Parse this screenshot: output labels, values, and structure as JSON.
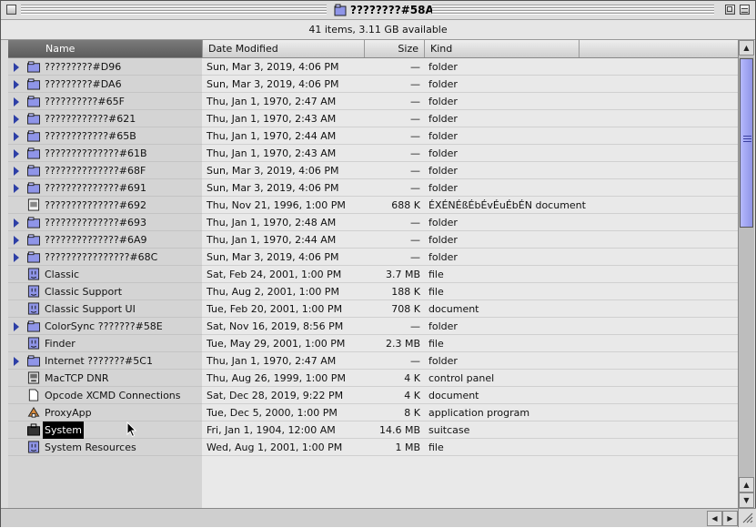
{
  "window": {
    "title": "????????#58A"
  },
  "status_text": "41 items, 3.11 GB available",
  "columns": {
    "name": "Name",
    "date": "Date Modified",
    "size": "Size",
    "kind": "Kind"
  },
  "rows": [
    {
      "name": "?????????#D96",
      "date": "Sun, Mar 3, 2019, 4:06 PM",
      "size": "—",
      "kind": "folder",
      "icon": "folder-icon",
      "expand": true
    },
    {
      "name": "?????????#DA6",
      "date": "Sun, Mar 3, 2019, 4:06 PM",
      "size": "—",
      "kind": "folder",
      "icon": "folder-icon",
      "expand": true
    },
    {
      "name": "??????????#65F",
      "date": "Thu, Jan 1, 1970, 2:47 AM",
      "size": "—",
      "kind": "folder",
      "icon": "folder-icon",
      "expand": true
    },
    {
      "name": "????????????#621",
      "date": "Thu, Jan 1, 1970, 2:43 AM",
      "size": "—",
      "kind": "folder",
      "icon": "folder-icon",
      "expand": true
    },
    {
      "name": "????????????#65B",
      "date": "Thu, Jan 1, 1970, 2:44 AM",
      "size": "—",
      "kind": "folder",
      "icon": "folder-icon",
      "expand": true
    },
    {
      "name": "??????????????#61B",
      "date": "Thu, Jan 1, 1970, 2:43 AM",
      "size": "—",
      "kind": "folder",
      "icon": "folder-icon",
      "expand": true
    },
    {
      "name": "??????????????#68F",
      "date": "Sun, Mar 3, 2019, 4:06 PM",
      "size": "—",
      "kind": "folder",
      "icon": "folder-icon",
      "expand": true
    },
    {
      "name": "??????????????#691",
      "date": "Sun, Mar 3, 2019, 4:06 PM",
      "size": "—",
      "kind": "folder",
      "icon": "folder-icon",
      "expand": true
    },
    {
      "name": "??????????????#692",
      "date": "Thu, Nov 21, 1996, 1:00 PM",
      "size": "688 K",
      "kind": "ÉXÉNÉßÉbÉvÉuÉbÉN document",
      "icon": "document-icon",
      "expand": false
    },
    {
      "name": "??????????????#693",
      "date": "Thu, Jan 1, 1970, 2:48 AM",
      "size": "—",
      "kind": "folder",
      "icon": "folder-icon",
      "expand": true
    },
    {
      "name": "??????????????#6A9",
      "date": "Thu, Jan 1, 1970, 2:44 AM",
      "size": "—",
      "kind": "folder",
      "icon": "folder-icon",
      "expand": true
    },
    {
      "name": "????????????????#68C",
      "date": "Sun, Mar 3, 2019, 4:06 PM",
      "size": "—",
      "kind": "folder",
      "icon": "folder-icon",
      "expand": true
    },
    {
      "name": "Classic",
      "date": "Sat, Feb 24, 2001, 1:00 PM",
      "size": "3.7 MB",
      "kind": "file",
      "icon": "mac-os-icon",
      "expand": false
    },
    {
      "name": "Classic Support",
      "date": "Thu, Aug 2, 2001, 1:00 PM",
      "size": "188 K",
      "kind": "file",
      "icon": "mac-os-icon",
      "expand": false
    },
    {
      "name": "Classic Support UI",
      "date": "Tue, Feb 20, 2001, 1:00 PM",
      "size": "708 K",
      "kind": "document",
      "icon": "mac-os-icon",
      "expand": false
    },
    {
      "name": "ColorSync ???????#58E",
      "date": "Sat, Nov 16, 2019, 8:56 PM",
      "size": "—",
      "kind": "folder",
      "icon": "folder-icon",
      "expand": true
    },
    {
      "name": "Finder",
      "date": "Tue, May 29, 2001, 1:00 PM",
      "size": "2.3 MB",
      "kind": "file",
      "icon": "finder-icon",
      "expand": false
    },
    {
      "name": "Internet ???????#5C1",
      "date": "Thu, Jan 1, 1970, 2:47 AM",
      "size": "—",
      "kind": "folder",
      "icon": "folder-icon",
      "expand": true
    },
    {
      "name": "MacTCP DNR",
      "date": "Thu, Aug 26, 1999, 1:00 PM",
      "size": "4 K",
      "kind": "control panel",
      "icon": "control-panel-icon",
      "expand": false
    },
    {
      "name": "Opcode XCMD Connections",
      "date": "Sat, Dec 28, 2019, 9:22 PM",
      "size": "4 K",
      "kind": "document",
      "icon": "blank-document-icon",
      "expand": false
    },
    {
      "name": "ProxyApp",
      "date": "Tue, Dec 5, 2000, 1:00 PM",
      "size": "8 K",
      "kind": "application program",
      "icon": "application-icon",
      "expand": false
    },
    {
      "name": "System",
      "date": "Fri, Jan 1, 1904, 12:00 AM",
      "size": "14.6 MB",
      "kind": "suitcase",
      "icon": "suitcase-icon",
      "expand": false,
      "selected": true
    },
    {
      "name": "System Resources",
      "date": "Wed, Aug 1, 2001, 1:00 PM",
      "size": "1 MB",
      "kind": "file",
      "icon": "mac-os-icon",
      "expand": false
    }
  ]
}
